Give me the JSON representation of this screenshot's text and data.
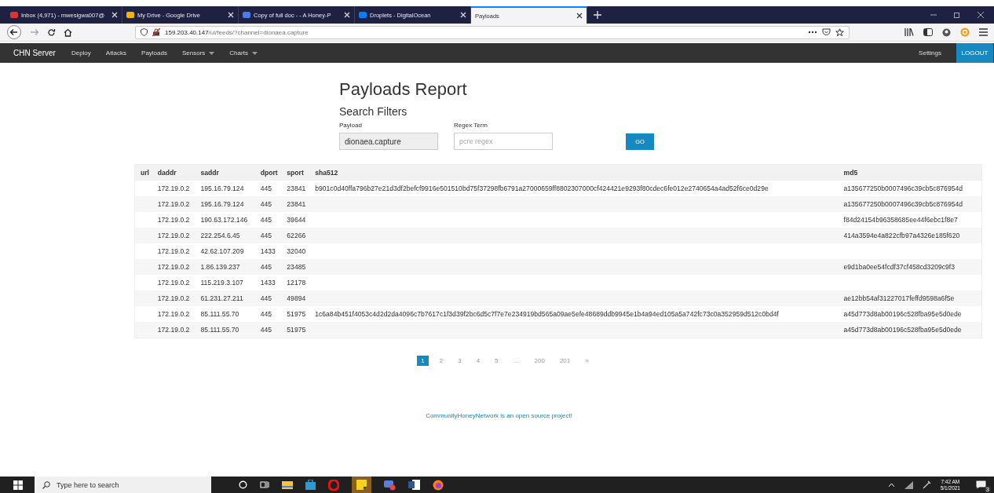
{
  "browser": {
    "tabs": [
      {
        "title": "Inbox (4,971) - mwesigwa007@",
        "selected": false
      },
      {
        "title": "My Drive - Google Drive",
        "selected": false
      },
      {
        "title": "Copy of full doc - - A Honey-P",
        "selected": false
      },
      {
        "title": "Droplets - DigitalOcean",
        "selected": false
      },
      {
        "title": "Payloads",
        "selected": true
      }
    ],
    "url": {
      "host": "159.203.40.147",
      "path": "/ui/feeds/?channel=dionaea.capture"
    }
  },
  "navbar": {
    "brand": "CHN Server",
    "items": [
      {
        "label": "Deploy",
        "dropdown": false
      },
      {
        "label": "Attacks",
        "dropdown": false
      },
      {
        "label": "Payloads",
        "dropdown": false
      },
      {
        "label": "Sensors",
        "dropdown": true
      },
      {
        "label": "Charts",
        "dropdown": true
      }
    ],
    "settings": "Settings",
    "logout": "LOGOUT"
  },
  "report": {
    "title": "Payloads Report",
    "filters_title": "Search Filters",
    "payload": {
      "label": "Payload",
      "value": "dionaea.capture"
    },
    "regex": {
      "label": "Regex Term",
      "placeholder": "pcre regex"
    },
    "go": "GO"
  },
  "table": {
    "columns": [
      "url",
      "daddr",
      "saddr",
      "dport",
      "sport",
      "sha512",
      "md5"
    ],
    "rows": [
      [
        "",
        "172.19.0.2",
        "195.16.79.124",
        "445",
        "23841",
        "b901c0d40ffa796b27e21d3df2befcf9916e501510bd75f37298fb6791a27000659ff8802307000cf424421e9293f80cdec6fe012e2740654a4ad52f6ce0d29e",
        "a135677250b0007496c39cb5c876954d"
      ],
      [
        "",
        "172.19.0.2",
        "195.16.79.124",
        "445",
        "23841",
        "",
        "a135677250b0007496c39cb5c876954d"
      ],
      [
        "",
        "172.19.0.2",
        "190.63.172.146",
        "445",
        "39644",
        "",
        "f84d24154b96358685ee44f6ebc1f8e7"
      ],
      [
        "",
        "172.19.0.2",
        "222.254.6.45",
        "445",
        "62266",
        "",
        "414a3594e4a822cfb97a4326e185f620"
      ],
      [
        "",
        "172.19.0.2",
        "42.62.107.209",
        "1433",
        "32040",
        "",
        ""
      ],
      [
        "",
        "172.19.0.2",
        "1.86.139.237",
        "445",
        "23485",
        "",
        "e9d1ba0ee54fcdf37cf458cd3209c9f3"
      ],
      [
        "",
        "172.19.0.2",
        "115.219.3.107",
        "1433",
        "12178",
        "",
        ""
      ],
      [
        "",
        "172.19.0.2",
        "61.231.27.211",
        "445",
        "49894",
        "",
        "ae12bb54af31227017feffd9598a6f5e"
      ],
      [
        "",
        "172.19.0.2",
        "85.111.55.70",
        "445",
        "51975",
        "1c6a84b451f4053c4d2d2da4096c7b7617c1f3d39f2bc6d5c7f7e7e234919bd565a09ae5efe48689ddb9945e1b4a94ed105a5a742fc73c0a352959d512c0bd4f",
        "a45d773d8ab00196c528fba95e5d0ede"
      ],
      [
        "",
        "172.19.0.2",
        "85.111.55.70",
        "445",
        "51975",
        "",
        "a45d773d8ab00196c528fba95e5d0ede"
      ]
    ]
  },
  "pagination": [
    {
      "label": "1",
      "selected": true
    },
    {
      "label": "2",
      "selected": false
    },
    {
      "label": "3",
      "selected": false
    },
    {
      "label": "4",
      "selected": false
    },
    {
      "label": "5",
      "selected": false
    },
    {
      "label": "…",
      "selected": false
    },
    {
      "label": "200",
      "selected": false
    },
    {
      "label": "201",
      "selected": false
    },
    {
      "label": "»",
      "selected": false
    }
  ],
  "footer": "CommunityHoneyNetwork is an open source project!",
  "taskbar": {
    "search_placeholder": "Type here to search",
    "time": "7:42 AM",
    "date": "5/1/2021",
    "notifications": "3"
  }
}
